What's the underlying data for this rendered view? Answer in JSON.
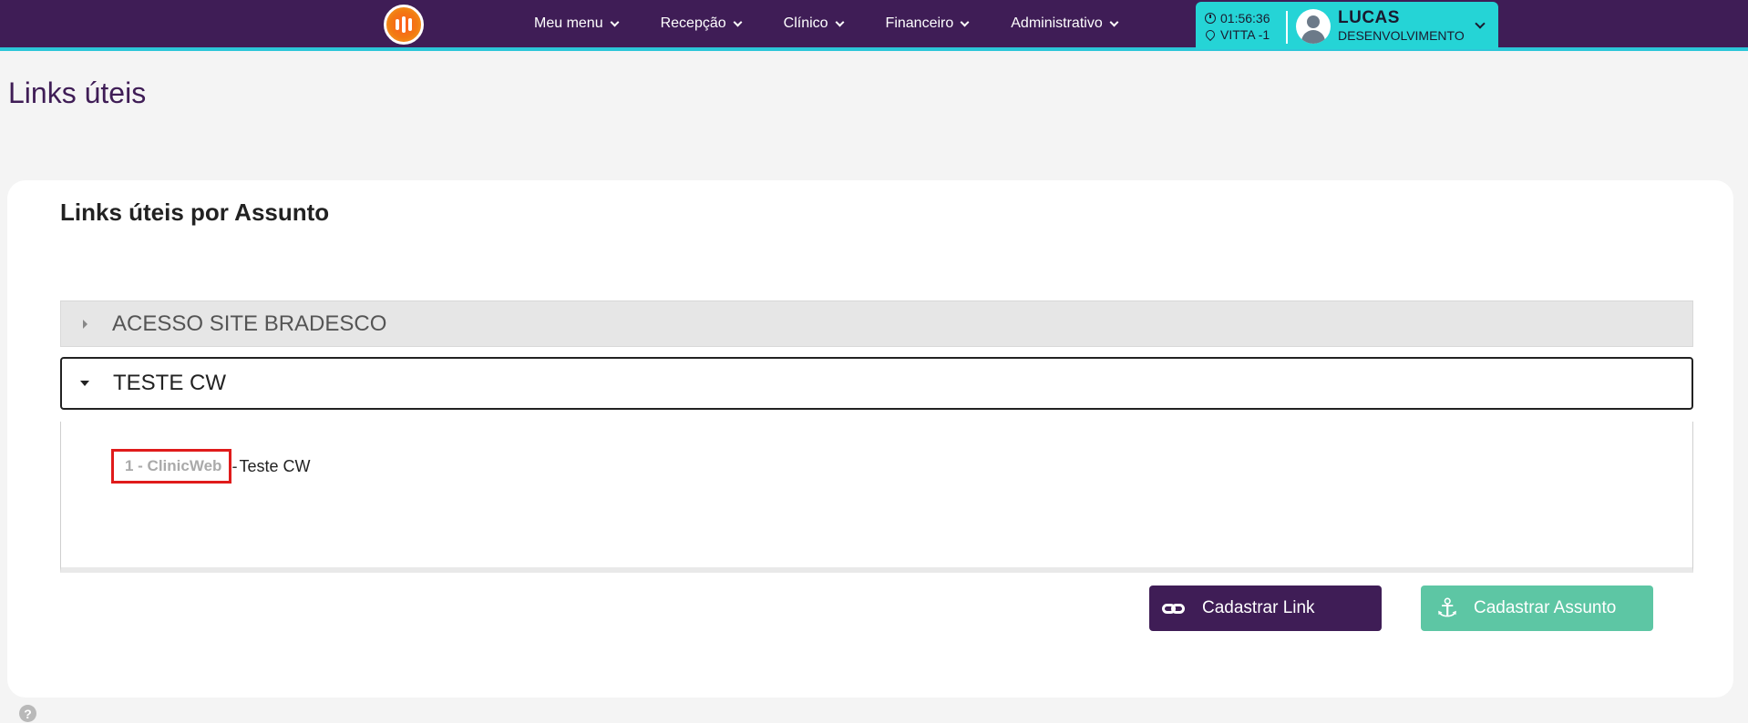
{
  "navbar": {
    "logo_icon": "logo-bars-icon",
    "menu": [
      {
        "label": "Meu menu"
      },
      {
        "label": "Recepção"
      },
      {
        "label": "Clínico"
      },
      {
        "label": "Financeiro"
      },
      {
        "label": "Administrativo"
      }
    ],
    "session": {
      "time": "01:56:36",
      "location": "VITTA -1"
    },
    "user": {
      "name": "LUCAS",
      "role": "DESENVOLVIMENTO"
    },
    "colors": {
      "primary": "#3f1d56",
      "accent": "#25d4d6"
    }
  },
  "page": {
    "title": "Links úteis"
  },
  "card": {
    "title": "Links úteis por Assunto",
    "subjects": [
      {
        "label": "ACESSO SITE BRADESCO",
        "expanded": false
      },
      {
        "label": "TESTE CW",
        "expanded": true
      }
    ],
    "links": [
      {
        "id": "1 - ClinicWeb",
        "separator": "-",
        "description": "Teste CW"
      }
    ],
    "buttons": {
      "add_link": "Cadastrar Link",
      "add_subject": "Cadastrar Assunto"
    },
    "colors": {
      "add_link_bg": "#3f1d56",
      "add_subject_bg": "#5dc6a4",
      "highlight": "#e01b1b"
    }
  },
  "help": {
    "label": "?"
  }
}
